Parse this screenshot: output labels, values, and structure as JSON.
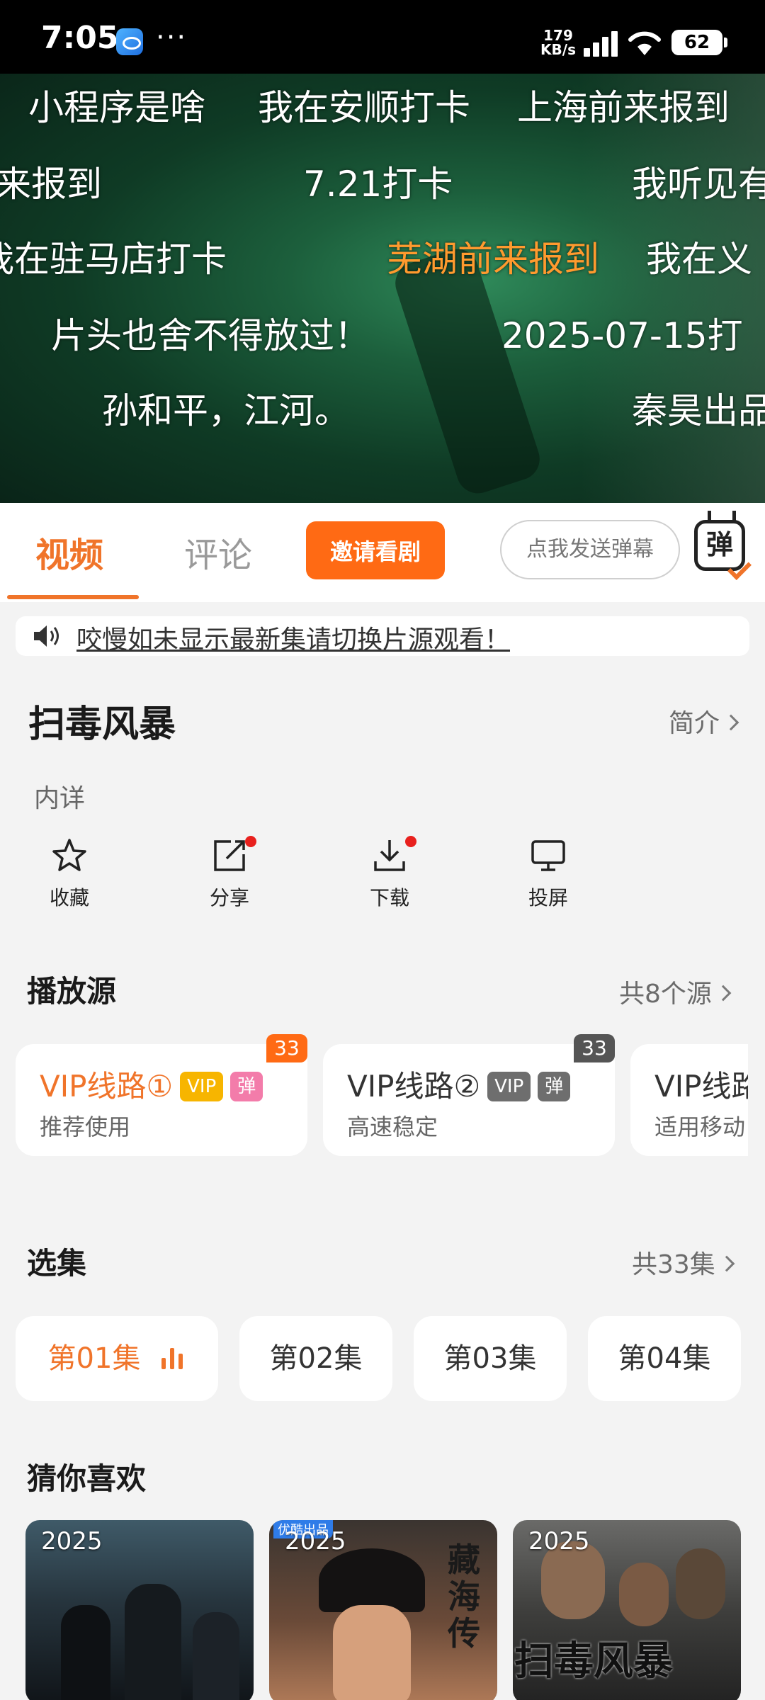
{
  "status_bar": {
    "time": "7:05",
    "dots": "···",
    "net_speed_value": "179",
    "net_speed_unit": "KB/s",
    "battery": "62"
  },
  "player": {
    "danmaku": [
      {
        "text": "小程序是啥",
        "color": "#ffffff"
      },
      {
        "text": "我在安顺打卡",
        "color": "#ffffff"
      },
      {
        "text": "上海前来报到",
        "color": "#ffffff"
      },
      {
        "text": "来报到",
        "color": "#ffffff"
      },
      {
        "text": "7.21打卡",
        "color": "#ffffff"
      },
      {
        "text": "我听见有",
        "color": "#ffffff"
      },
      {
        "text": "我在驻马店打卡",
        "color": "#ffffff"
      },
      {
        "text": "芜湖前来报到",
        "color": "#ff9a2e"
      },
      {
        "text": "我在义",
        "color": "#ffffff"
      },
      {
        "text": "片头也舍不得放过！",
        "color": "#ffffff"
      },
      {
        "text": "2025-07-15打",
        "color": "#ffffff"
      },
      {
        "text": "孙和平，江河。",
        "color": "#ffffff"
      },
      {
        "text": "秦昊出品",
        "color": "#ffffff"
      }
    ]
  },
  "tabs": {
    "video": "视频",
    "comments": "评论",
    "invite_button": "邀请看剧",
    "danmu_placeholder": "点我发送弹幕",
    "danmu_toggle": "弹"
  },
  "notice": {
    "text": "咬慢如未显示最新集请切换片源观看！"
  },
  "show": {
    "title": "扫毒风暴",
    "intro_link": "简介",
    "subtitle": "内详"
  },
  "actions": [
    {
      "label": "收藏",
      "icon": "star-icon"
    },
    {
      "label": "分享",
      "icon": "share-icon"
    },
    {
      "label": "下载",
      "icon": "download-icon"
    },
    {
      "label": "投屏",
      "icon": "cast-icon"
    }
  ],
  "sources": {
    "title": "播放源",
    "more": "共8个源",
    "items": [
      {
        "name": "VIP线路①",
        "tag1": "VIP",
        "tag2": "弹",
        "desc": "推荐使用",
        "count": "33"
      },
      {
        "name": "VIP线路②",
        "tag1": "VIP",
        "tag2": "弹",
        "desc": "高速稳定",
        "count": "33"
      },
      {
        "name": "VIP线路",
        "desc": "适用移动"
      }
    ]
  },
  "episodes": {
    "title": "选集",
    "more": "共33集",
    "items": [
      "第01集",
      "第02集",
      "第03集",
      "第04集"
    ]
  },
  "recommend": {
    "title": "猜你喜欢",
    "items": [
      {
        "year": "2025"
      },
      {
        "year": "2025",
        "badge": "优酷出品",
        "poster_title": "藏海传"
      },
      {
        "year": "2025",
        "poster_title": "扫毒风暴"
      }
    ]
  },
  "colors": {
    "accent": "#f0742a",
    "invite_button": "#ff6a14",
    "vip_active_tag": "#f7b500",
    "danmu_active_tag": "#f37caa",
    "vip_tag": "#6e6e6e"
  }
}
